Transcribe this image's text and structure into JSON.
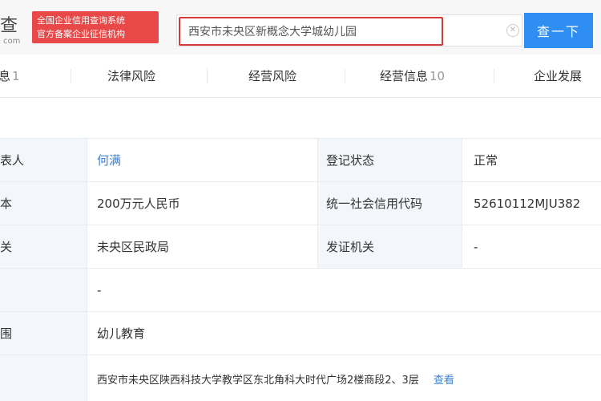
{
  "logo": {
    "main": "查",
    "sub": "com",
    "icon": "logo-icon"
  },
  "badge": {
    "text": "全国企业信用查询系统\n官方备案企业征信机构"
  },
  "search": {
    "value": "西安市未央区新概念大学城幼儿园",
    "button_label": "查一下",
    "clear_icon": "close-circle-icon"
  },
  "tabs": [
    {
      "label": "基本信息",
      "visible": "息",
      "count": "1"
    },
    {
      "label": "法律风险",
      "count": ""
    },
    {
      "label": "经营风险",
      "count": ""
    },
    {
      "label": "经营信息",
      "count": "10"
    },
    {
      "label": "企业发展",
      "count": ""
    }
  ],
  "info": {
    "legal_rep_label": "表人",
    "legal_rep_value": "何满",
    "status_label": "登记状态",
    "status_value": "正常",
    "capital_label": "本",
    "capital_value": "200万元人民币",
    "credit_code_label": "统一社会信用代码",
    "credit_code_value": "52610112MJU382",
    "authority_label": "关",
    "authority_value": "未央区民政局",
    "issuer_label": "发证机关",
    "issuer_value": "-",
    "blank_value": "-",
    "scope_label": "围",
    "scope_value": "幼儿教育",
    "address_value": "西安市未央区陕西科技大学教学区东北角科大时代广场2楼商段2、3层",
    "address_more": "查看"
  },
  "colors": {
    "accent": "#2f8ef2",
    "badge": "#e84848",
    "highlight_border": "#d63a3a",
    "label_bg": "#f3f6fa",
    "link": "#3b82d6"
  }
}
